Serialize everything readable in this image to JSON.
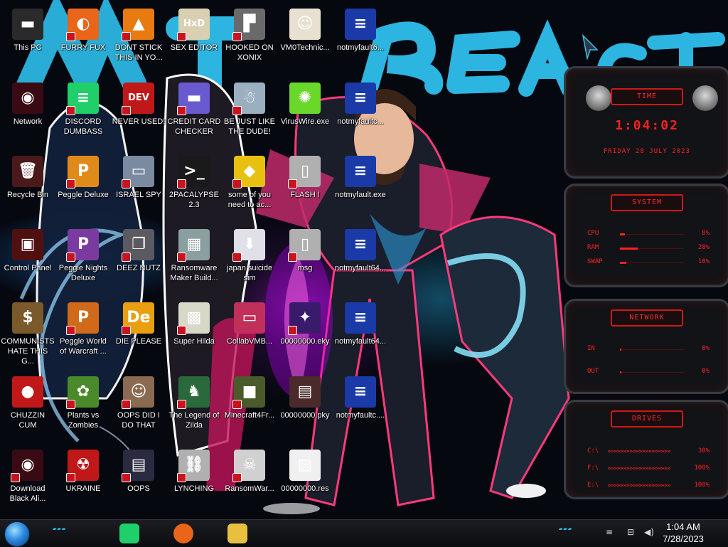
{
  "desktop": {
    "icons": [
      {
        "label": "This PC",
        "icon": "computer-icon",
        "glyph": "▬",
        "bg": "#2a2a2a",
        "shield": false
      },
      {
        "label": "Network",
        "icon": "alien-network-icon",
        "glyph": "◉",
        "bg": "#3a0a14",
        "shield": false
      },
      {
        "label": "Recycle Bin",
        "icon": "recycle-bin-icon",
        "glyph": "🗑",
        "bg": "#4a1a1a",
        "shield": false
      },
      {
        "label": "Control Panel",
        "icon": "control-panel-icon",
        "glyph": "▣",
        "bg": "#501010",
        "shield": false
      },
      {
        "label": "COMMUNISTS HATE THIS G...",
        "icon": "money-bag-icon",
        "glyph": "$",
        "bg": "#7a5a2a",
        "shield": false
      },
      {
        "label": "CHUZZIN CUM",
        "icon": "chuzzle-icon",
        "glyph": "●",
        "bg": "#c01818",
        "shield": false
      },
      {
        "label": "Download Black Ali...",
        "icon": "alien-download-icon",
        "glyph": "◉",
        "bg": "#3a0a14",
        "shield": true
      },
      {
        "label": "FURRY FUX",
        "icon": "firefox-icon",
        "glyph": "◐",
        "bg": "#e8651a",
        "shield": true
      },
      {
        "label": "DISCORD DUMBASS",
        "icon": "chat-app-icon",
        "glyph": "≡",
        "bg": "#1fcf6a",
        "shield": true
      },
      {
        "label": "Peggle Deluxe",
        "icon": "peggle-icon",
        "glyph": "P",
        "bg": "#e08a1a",
        "shield": true
      },
      {
        "label": "Peggle Nights Deluxe",
        "icon": "peggle-nights-icon",
        "glyph": "P",
        "bg": "#7a3aa0",
        "shield": true
      },
      {
        "label": "Peggle World of Warcraft ...",
        "icon": "peggle-wow-icon",
        "glyph": "P",
        "bg": "#d06a1a",
        "shield": true
      },
      {
        "label": "Plants vs Zombies",
        "icon": "plants-vs-zombies-icon",
        "glyph": "✿",
        "bg": "#4a8a2a",
        "shield": true
      },
      {
        "label": "UKRAINE",
        "icon": "radiation-icon",
        "glyph": "☢",
        "bg": "#c01818",
        "shield": true
      },
      {
        "label": "DONT STICK THIS IN YO...",
        "icon": "vlc-cone-icon",
        "glyph": "▲",
        "bg": "#e87a10",
        "shield": true
      },
      {
        "label": "NEVER USED!",
        "icon": "dev-cpp-icon",
        "glyph": "DEV",
        "bg": "#c01818",
        "shield": true
      },
      {
        "label": "ISRAEL SPY",
        "icon": "spy-window-icon",
        "glyph": "▭",
        "bg": "#7a8aa0",
        "shield": true
      },
      {
        "label": "DEEZ NUTZ",
        "icon": "stacked-windows-icon",
        "glyph": "❐",
        "bg": "#5a5a60",
        "shield": true
      },
      {
        "label": "DIE PLEASE",
        "icon": "die-icon",
        "glyph": "De",
        "bg": "#e8a010",
        "shield": true
      },
      {
        "label": "OOPS DID I DO THAT",
        "icon": "portrait-icon",
        "glyph": "☺",
        "bg": "#8a6a50",
        "shield": true
      },
      {
        "label": "OOPS",
        "icon": "book-icon",
        "glyph": "▤",
        "bg": "#2a2a40",
        "shield": true
      },
      {
        "label": "SEX EDITOR",
        "icon": "hex-editor-icon",
        "glyph": "HxD",
        "bg": "#d8d0b0",
        "shield": true
      },
      {
        "label": "CREDIT CARD CHECKER",
        "icon": "credit-card-icon",
        "glyph": "▬",
        "bg": "#6a5ad0",
        "shield": true
      },
      {
        "label": "2PACALYPSE 2.3",
        "icon": "terminal-icon",
        "glyph": ">_",
        "bg": "#1a1a1a",
        "shield": true
      },
      {
        "label": "Ransomware Maker Build...",
        "icon": "window-app-icon",
        "glyph": "▦",
        "bg": "#8aa0a0",
        "shield": true
      },
      {
        "label": "Super Hilda",
        "icon": "pixel-cat-icon",
        "glyph": "▩",
        "bg": "#d8d8c8",
        "shield": true
      },
      {
        "label": "The Legend of Zilda",
        "icon": "pixel-hero-icon",
        "glyph": "♞",
        "bg": "#2a6a3a",
        "shield": true
      },
      {
        "label": "LYNCHING",
        "icon": "chain-icon",
        "glyph": "⛓",
        "bg": "#b0b0b0",
        "shield": true
      },
      {
        "label": "HOOKED ON XONIX",
        "icon": "xonix-icon",
        "glyph": "▛",
        "bg": "#6a6a6a",
        "shield": true
      },
      {
        "label": "BE JUST LIKE THE DUDE!",
        "icon": "santa-icon",
        "glyph": "☃",
        "bg": "#9ab0c0",
        "shield": true
      },
      {
        "label": "some of you need to ac...",
        "icon": "beaver-icon",
        "glyph": "◆",
        "bg": "#e8c010",
        "shield": true
      },
      {
        "label": "japan suicide sim",
        "icon": "setup-icon",
        "glyph": "⬇",
        "bg": "#e0e0e8",
        "shield": true
      },
      {
        "label": "CollabVMB...",
        "icon": "monitor-icon",
        "glyph": "▭",
        "bg": "#c0305a",
        "shield": false
      },
      {
        "label": "Minecraft4Fr...",
        "icon": "minecraft-icon",
        "glyph": "■",
        "bg": "#4a5a2a",
        "shield": true
      },
      {
        "label": "RansomWar...",
        "icon": "skull-icon",
        "glyph": "☠",
        "bg": "#d0d0d0",
        "shield": true
      },
      {
        "label": "VM0Technic...",
        "icon": "doctor-icon",
        "glyph": "☺",
        "bg": "#e8e0d0",
        "shield": false
      },
      {
        "label": "VirusWire.exe",
        "icon": "lime-icon",
        "glyph": "✺",
        "bg": "#6ad82a",
        "shield": false
      },
      {
        "label": "FLASH !",
        "icon": "flash-file-icon",
        "glyph": "▯",
        "bg": "#b0b0b0",
        "shield": true
      },
      {
        "label": "msg",
        "icon": "msg-file-icon",
        "glyph": "▯",
        "bg": "#b0b0b0",
        "shield": true
      },
      {
        "label": "00000000.eky",
        "icon": "galaxy-icon",
        "glyph": "✦",
        "bg": "#3a1a6a",
        "shield": true
      },
      {
        "label": "00000000.pky",
        "icon": "book-icon",
        "glyph": "▤",
        "bg": "#4a2a2a",
        "shield": false
      },
      {
        "label": "00000000.res",
        "icon": "chart-file-icon",
        "glyph": "▨",
        "bg": "#f0f0f0",
        "shield": false
      },
      {
        "label": "notmyfault6...",
        "icon": "bsod-icon",
        "glyph": "≡",
        "bg": "#1a3aa8",
        "shield": false
      },
      {
        "label": "notmyfaultc...",
        "icon": "bsod-icon",
        "glyph": "≡",
        "bg": "#1a3aa8",
        "shield": false
      },
      {
        "label": "notmyfault.exe",
        "icon": "bsod-icon",
        "glyph": "≡",
        "bg": "#1a3aa8",
        "shield": false
      },
      {
        "label": "notmyfault64...",
        "icon": "bsod-icon",
        "glyph": "≡",
        "bg": "#1a3aa8",
        "shield": false
      },
      {
        "label": "notmyfault64...",
        "icon": "bsod-icon",
        "glyph": "≡",
        "bg": "#1a3aa8",
        "shield": false
      },
      {
        "label": "notmyfaultc....",
        "icon": "bsod-icon",
        "glyph": "≡",
        "bg": "#1a3aa8",
        "shield": false
      }
    ]
  },
  "gadgets": {
    "time": {
      "title": "TIME",
      "clock": "1:04:02",
      "date": "FRIDAY 28 JULY 2023"
    },
    "system": {
      "title": "SYSTEM",
      "rows": [
        {
          "name": "CPU",
          "value": "8%",
          "fill": 0.08
        },
        {
          "name": "RAM",
          "value": "28%",
          "fill": 0.28
        },
        {
          "name": "SWAP",
          "value": "10%",
          "fill": 0.1
        }
      ]
    },
    "network": {
      "title": "NETWORK",
      "rows": [
        {
          "name": "IN",
          "value": "0%",
          "fill": 0.0
        },
        {
          "name": "OUT",
          "value": "0%",
          "fill": 0.0
        }
      ]
    },
    "drives": {
      "title": "DRIVES",
      "rows": [
        {
          "name": "C:\\",
          "value": "30%"
        },
        {
          "name": "F:\\",
          "value": "100%"
        },
        {
          "name": "E:\\",
          "value": "100%"
        }
      ]
    }
  },
  "taskbar": {
    "apps": [
      {
        "icon": "chat-app-icon",
        "bg": "#1fcf6a"
      },
      {
        "icon": "firefox-icon",
        "bg": "#e8651a"
      },
      {
        "icon": "file-explorer-icon",
        "bg": "#e8c040"
      }
    ],
    "time": "1:04 AM",
    "date": "7/28/2023"
  },
  "colors": {
    "accent": "#ff2020",
    "cyan": "#27b7e8"
  }
}
